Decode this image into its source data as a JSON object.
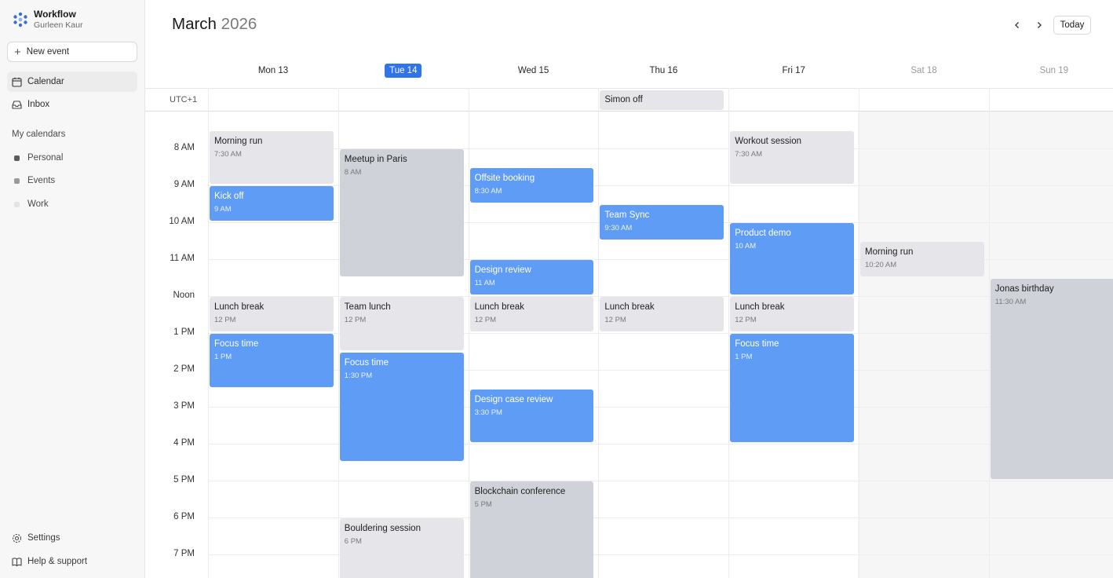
{
  "sidebar": {
    "app_name": "Workflow",
    "user_name": "Gurleen Kaur",
    "new_event_label": "New event",
    "nav": [
      {
        "label": "Calendar",
        "icon": "calendar-icon"
      },
      {
        "label": "Inbox",
        "icon": "inbox-icon"
      }
    ],
    "section_label": "My calendars",
    "calendars": [
      {
        "label": "Personal",
        "color": "#5c5c5c"
      },
      {
        "label": "Events",
        "color": "#9a9a9a"
      },
      {
        "label": "Work",
        "color": "#e4e4e4"
      }
    ],
    "bottom": [
      {
        "label": "Settings",
        "icon": "gear-icon"
      },
      {
        "label": "Help & support",
        "icon": "book-icon"
      }
    ]
  },
  "header": {
    "month": "March",
    "year": "2026",
    "today_label": "Today"
  },
  "days": [
    "Mon 13",
    "Tue 14",
    "Wed 15",
    "Thu 16",
    "Fri 17",
    "Sat 18",
    "Sun 19"
  ],
  "timezone": "UTC+1",
  "hours": [
    "8 AM",
    "9 AM",
    "10 AM",
    "11 AM",
    "Noon",
    "1 PM",
    "2 PM",
    "3 PM",
    "4 PM",
    "5 PM",
    "6 PM",
    "7 PM"
  ],
  "all_day_events": [
    {
      "title": "Simon off",
      "day": 3
    }
  ],
  "events": [
    {
      "title": "Morning run",
      "time": "7:30 AM",
      "day": 0,
      "start": 7.5,
      "end": 9.0,
      "style": "grey"
    },
    {
      "title": "Kick off",
      "time": "9 AM",
      "day": 0,
      "start": 9.0,
      "end": 10.0,
      "style": "blue"
    },
    {
      "title": "Lunch break",
      "time": "12 PM",
      "day": 0,
      "start": 12.0,
      "end": 13.0,
      "style": "grey"
    },
    {
      "title": "Focus time",
      "time": "1 PM",
      "day": 0,
      "start": 13.0,
      "end": 14.5,
      "style": "blue"
    },
    {
      "title": "Meetup in Paris",
      "time": "8 AM",
      "day": 1,
      "start": 8.0,
      "end": 11.5,
      "style": "slate"
    },
    {
      "title": "Team lunch",
      "time": "12 PM",
      "day": 1,
      "start": 12.0,
      "end": 13.5,
      "style": "grey"
    },
    {
      "title": "Focus time",
      "time": "1:30 PM",
      "day": 1,
      "start": 13.5,
      "end": 16.5,
      "style": "blue"
    },
    {
      "title": "Bouldering session",
      "time": "6 PM",
      "day": 1,
      "start": 18.0,
      "end": 20.0,
      "style": "grey"
    },
    {
      "title": "Offsite booking",
      "time": "8:30 AM",
      "day": 2,
      "start": 8.5,
      "end": 9.5,
      "style": "blue"
    },
    {
      "title": "Design review",
      "time": "11 AM",
      "day": 2,
      "start": 11.0,
      "end": 12.0,
      "style": "blue"
    },
    {
      "title": "Lunch break",
      "time": "12 PM",
      "day": 2,
      "start": 12.0,
      "end": 13.0,
      "style": "grey"
    },
    {
      "title": "Design case review",
      "time": "3:30 PM",
      "day": 2,
      "start": 14.5,
      "end": 16.0,
      "style": "blue"
    },
    {
      "title": "Blockchain conference",
      "time": "5 PM",
      "day": 2,
      "start": 17.0,
      "end": 20.0,
      "style": "slate"
    },
    {
      "title": "Team Sync",
      "time": "9:30 AM",
      "day": 3,
      "start": 9.5,
      "end": 10.5,
      "style": "blue"
    },
    {
      "title": "Lunch break",
      "time": "12 PM",
      "day": 3,
      "start": 12.0,
      "end": 13.0,
      "style": "grey"
    },
    {
      "title": "Workout session",
      "time": "7:30 AM",
      "day": 4,
      "start": 7.5,
      "end": 9.0,
      "style": "grey"
    },
    {
      "title": "Product demo",
      "time": "10 AM",
      "day": 4,
      "start": 10.0,
      "end": 12.0,
      "style": "blue"
    },
    {
      "title": "Lunch break",
      "time": "12 PM",
      "day": 4,
      "start": 12.0,
      "end": 13.0,
      "style": "grey"
    },
    {
      "title": "Focus time",
      "time": "1 PM",
      "day": 4,
      "start": 13.0,
      "end": 16.0,
      "style": "blue"
    },
    {
      "title": "Morning run",
      "time": "10:20 AM",
      "day": 5,
      "start": 10.5,
      "end": 11.5,
      "style": "grey"
    },
    {
      "title": "Jonas birthday",
      "time": "11:30 AM",
      "day": 6,
      "start": 11.5,
      "end": 17.0,
      "style": "slate"
    }
  ]
}
